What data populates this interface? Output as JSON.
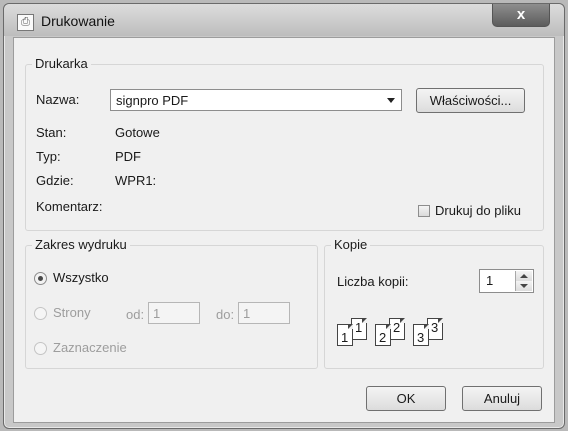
{
  "window": {
    "title": "Drukowanie",
    "close_label": "x"
  },
  "printer": {
    "group_label": "Drukarka",
    "name_label": "Nazwa:",
    "name_value": "signpro PDF",
    "properties_label": "Właściwości...",
    "status_label": "Stan:",
    "status_value": "Gotowe",
    "type_label": "Typ:",
    "type_value": "PDF",
    "where_label": "Gdzie:",
    "where_value": "WPR1:",
    "comment_label": "Komentarz:",
    "print_to_file_label": "Drukuj do pliku"
  },
  "range": {
    "group_label": "Zakres wydruku",
    "all_label": "Wszystko",
    "pages_label": "Strony",
    "from_label": "od:",
    "from_value": "1",
    "to_label": "do:",
    "to_value": "1",
    "selection_label": "Zaznaczenie"
  },
  "copies": {
    "group_label": "Kopie",
    "count_label": "Liczba kopii:",
    "count_value": "1",
    "collate": [
      {
        "front": "1",
        "back": "1"
      },
      {
        "front": "2",
        "back": "2"
      },
      {
        "front": "3",
        "back": "3"
      }
    ]
  },
  "actions": {
    "ok_label": "OK",
    "cancel_label": "Anuluj"
  }
}
